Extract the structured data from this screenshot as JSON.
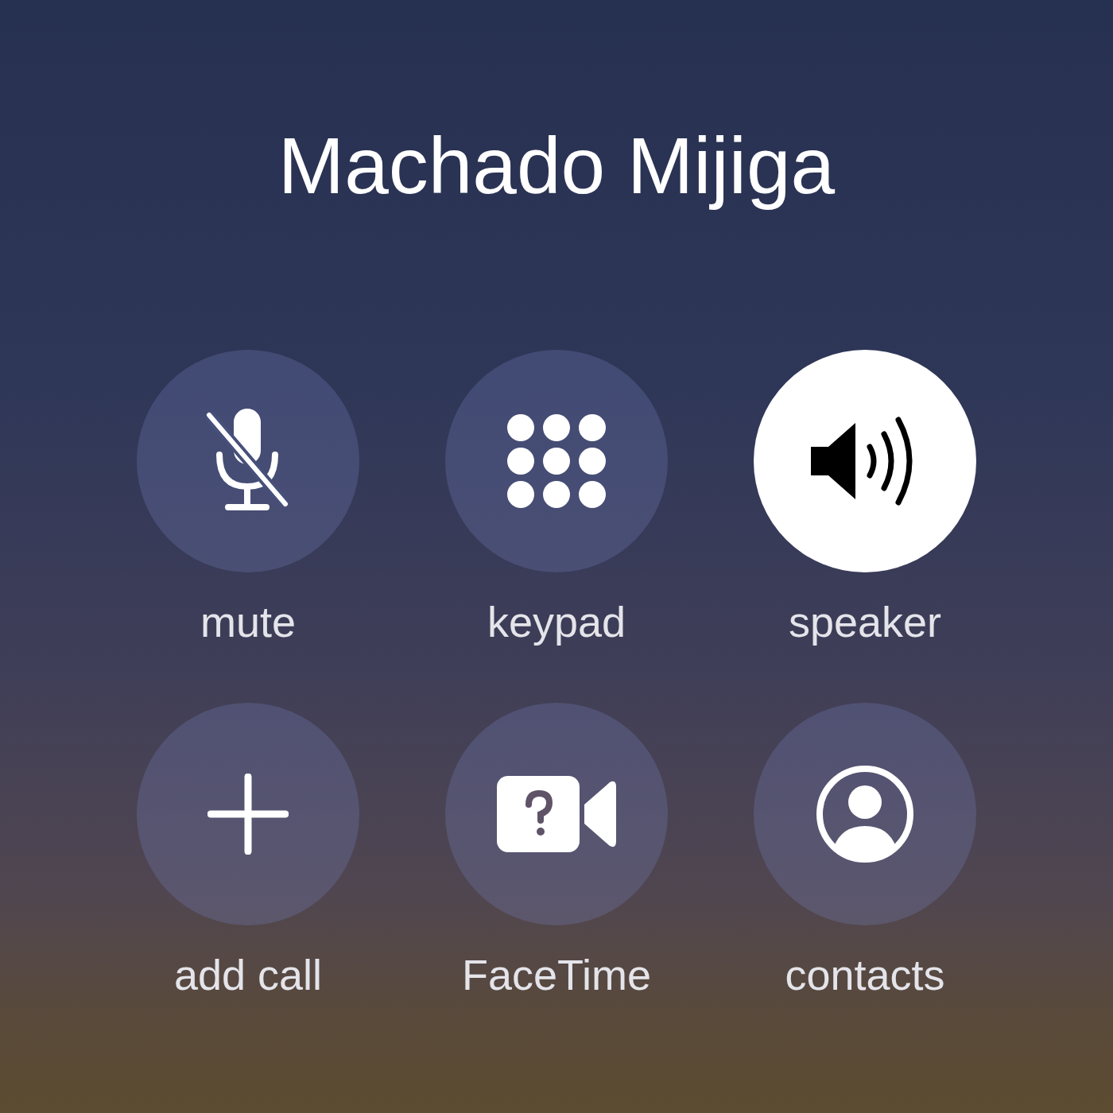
{
  "caller": {
    "name": "Machado Mijiga"
  },
  "buttons": [
    {
      "kind": "mute",
      "label": "mute",
      "on": false
    },
    {
      "kind": "keypad",
      "label": "keypad",
      "on": false
    },
    {
      "kind": "speaker",
      "label": "speaker",
      "on": true
    },
    {
      "kind": "add_call",
      "label": "add call",
      "on": false
    },
    {
      "kind": "facetime",
      "label": "FaceTime",
      "on": false
    },
    {
      "kind": "contacts",
      "label": "contacts",
      "on": false
    }
  ]
}
